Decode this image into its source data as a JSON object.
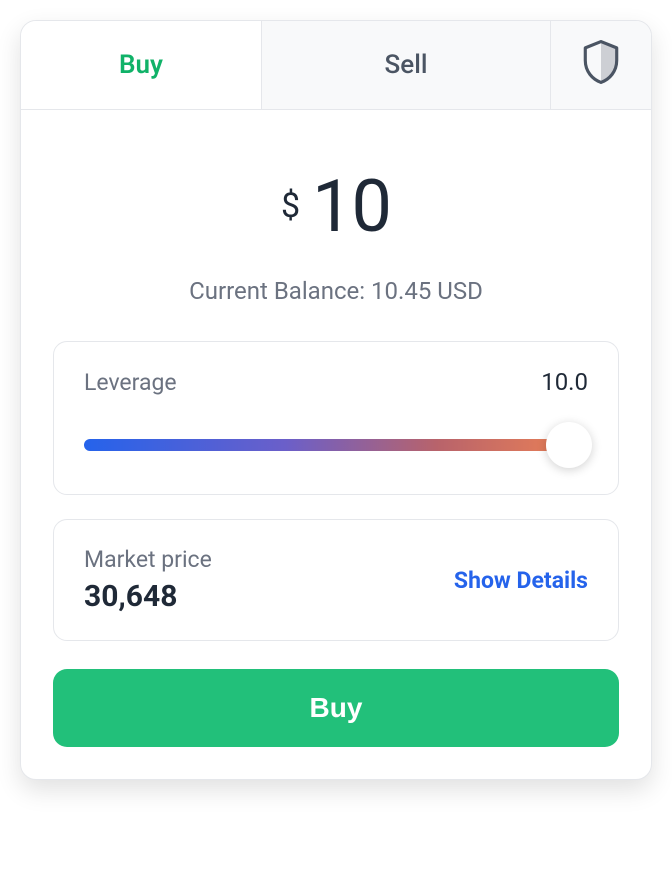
{
  "tabs": {
    "buy": "Buy",
    "sell": "Sell"
  },
  "amount": {
    "currency_symbol": "$",
    "value": "10"
  },
  "balance": {
    "label": "Current Balance: ",
    "value": "10.45 USD"
  },
  "leverage": {
    "label": "Leverage",
    "value": "10.0"
  },
  "market": {
    "label": "Market price",
    "value": "30,648",
    "details_label": "Show Details"
  },
  "action": {
    "buy_label": "Buy"
  }
}
